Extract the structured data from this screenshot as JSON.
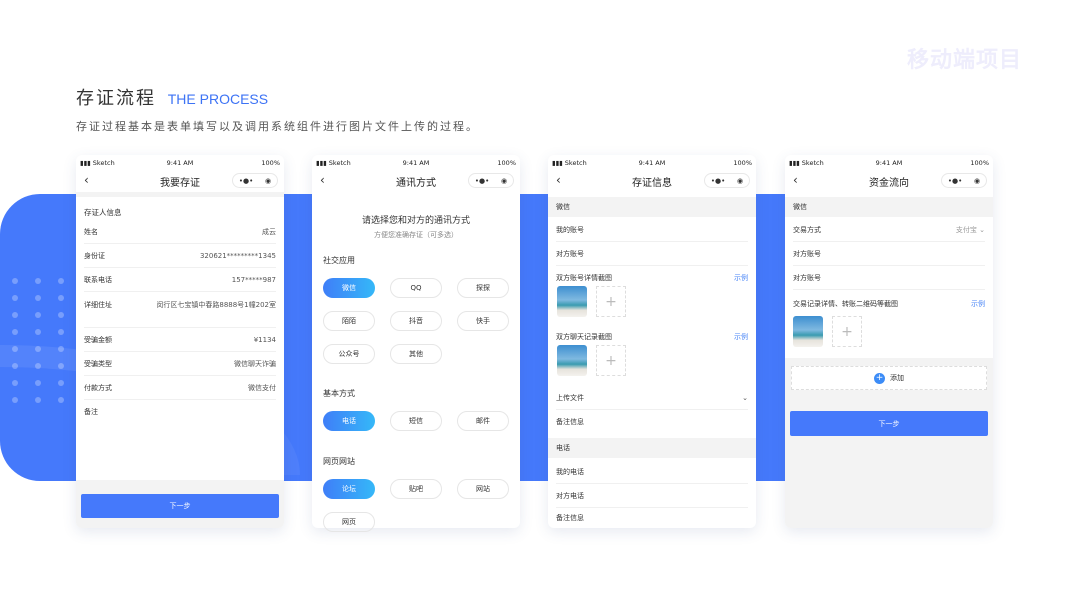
{
  "watermark": "移动端项目",
  "header": {
    "title": "存证流程",
    "title_en": "THE PROCESS",
    "subtitle": "存证过程基本是表单填写以及调用系统组件进行图片文件上传的过程。"
  },
  "colors": {
    "accent": "#4579fb",
    "link": "#4a86f7"
  },
  "status_bar": {
    "carrier": "Sketch",
    "time": "9:41 AM",
    "battery": "100%"
  },
  "screens": [
    {
      "title": "我要存证",
      "section": "存证人信息",
      "rows": [
        {
          "label": "姓名",
          "value": "成云"
        },
        {
          "label": "身份证",
          "value": "320621*********1345"
        },
        {
          "label": "联系电话",
          "value": "157*****987"
        },
        {
          "label": "详细住址",
          "value": "闵行区七宝镇中春路8888号1幢202室"
        },
        {
          "label": "受骗金额",
          "value": "¥1134"
        },
        {
          "label": "受骗类型",
          "value": "微信聊天诈骗"
        },
        {
          "label": "付款方式",
          "value": "微信支付"
        },
        {
          "label": "备注",
          "value": ""
        }
      ],
      "next": "下一步"
    },
    {
      "title": "通讯方式",
      "heading": "请选择您和对方的通讯方式",
      "hint": "方便您准确存证（可多选）",
      "groups": [
        {
          "name": "社交应用",
          "options": [
            {
              "label": "微信",
              "selected": true
            },
            {
              "label": "QQ",
              "selected": false
            },
            {
              "label": "探探",
              "selected": false
            },
            {
              "label": "陌陌",
              "selected": false
            },
            {
              "label": "抖音",
              "selected": false
            },
            {
              "label": "快手",
              "selected": false
            },
            {
              "label": "公众号",
              "selected": false
            },
            {
              "label": "其他",
              "selected": false
            }
          ]
        },
        {
          "name": "基本方式",
          "options": [
            {
              "label": "电话",
              "selected": true
            },
            {
              "label": "短信",
              "selected": false
            },
            {
              "label": "邮件",
              "selected": false
            }
          ]
        },
        {
          "name": "网页网站",
          "options": [
            {
              "label": "论坛",
              "selected": true
            },
            {
              "label": "贴吧",
              "selected": false
            },
            {
              "label": "网站",
              "selected": false
            },
            {
              "label": "网页",
              "selected": false
            }
          ]
        }
      ]
    },
    {
      "title": "存证信息",
      "wechat": "微信",
      "my_account": "我的账号",
      "peer_account": "对方账号",
      "account_shots": "双方账号详情截图",
      "chat_shots": "双方聊天记录截图",
      "example": "示例",
      "upload": "上传文件",
      "note": "备注信息",
      "phone": "电话",
      "my_phone": "我的电话",
      "peer_phone": "对方电话"
    },
    {
      "title": "资金流向",
      "wechat": "微信",
      "trade_method": "交易方式",
      "trade_value": "支付宝",
      "peer_account": "对方账号",
      "shots": "交易记录详情、转账二维码等截图",
      "example": "示例",
      "add": "添加",
      "next": "下一步"
    }
  ]
}
